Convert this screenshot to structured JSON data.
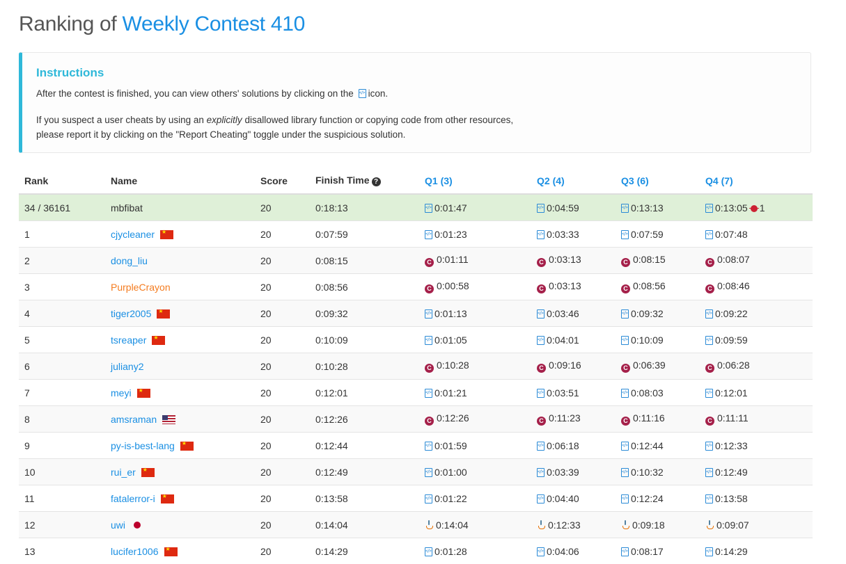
{
  "header": {
    "title_prefix": "Ranking of",
    "contest_name": "Weekly Contest 410"
  },
  "instructions": {
    "title": "Instructions",
    "p1_before": "After the contest is finished, you can view others' solutions by clicking on the",
    "p1_after": "icon.",
    "p2_line1_before": "If you suspect a user cheats by using an",
    "p2_emphasis": "explicitly",
    "p2_line1_after": "disallowed library function or copying code from other resources,",
    "p2_line2": "please report it by clicking on the \"Report Cheating\" toggle under the suspicious solution."
  },
  "table": {
    "headers": {
      "rank": "Rank",
      "name": "Name",
      "score": "Score",
      "finish": "Finish Time",
      "q1": "Q1 (3)",
      "q2": "Q2 (4)",
      "q3": "Q3 (6)",
      "q4": "Q4 (7)"
    },
    "current_user": {
      "rank": "34 / 36161",
      "name": "mbfibat",
      "score": "20",
      "finish": "0:18:13",
      "q1": "0:01:47",
      "q2": "0:04:59",
      "q3": "0:13:13",
      "q4": "0:13:05",
      "q4_bugs": "1"
    },
    "rows": [
      {
        "rank": "1",
        "name": "cjycleaner",
        "flag": "cn",
        "color": "blue",
        "score": "20",
        "finish": "0:07:59",
        "lang": "code",
        "q1": "0:01:23",
        "q2": "0:03:33",
        "q3": "0:07:59",
        "q4": "0:07:48"
      },
      {
        "rank": "2",
        "name": "dong_liu",
        "flag": "",
        "color": "blue",
        "score": "20",
        "finish": "0:08:15",
        "lang": "cpp",
        "q1": "0:01:11",
        "q2": "0:03:13",
        "q3": "0:08:15",
        "q4": "0:08:07"
      },
      {
        "rank": "3",
        "name": "PurpleCrayon",
        "flag": "",
        "color": "orange",
        "score": "20",
        "finish": "0:08:56",
        "lang": "cpp",
        "q1": "0:00:58",
        "q2": "0:03:13",
        "q3": "0:08:56",
        "q4": "0:08:46"
      },
      {
        "rank": "4",
        "name": "tiger2005",
        "flag": "cn",
        "color": "blue",
        "score": "20",
        "finish": "0:09:32",
        "lang": "code",
        "q1": "0:01:13",
        "q2": "0:03:46",
        "q3": "0:09:32",
        "q4": "0:09:22"
      },
      {
        "rank": "5",
        "name": "tsreaper",
        "flag": "cn",
        "color": "blue",
        "score": "20",
        "finish": "0:10:09",
        "lang": "code",
        "q1": "0:01:05",
        "q2": "0:04:01",
        "q3": "0:10:09",
        "q4": "0:09:59"
      },
      {
        "rank": "6",
        "name": "juliany2",
        "flag": "",
        "color": "blue",
        "score": "20",
        "finish": "0:10:28",
        "lang": "cpp",
        "q1": "0:10:28",
        "q2": "0:09:16",
        "q3": "0:06:39",
        "q4": "0:06:28"
      },
      {
        "rank": "7",
        "name": "meyi",
        "flag": "cn",
        "color": "blue",
        "score": "20",
        "finish": "0:12:01",
        "lang": "code",
        "q1": "0:01:21",
        "q2": "0:03:51",
        "q3": "0:08:03",
        "q4": "0:12:01"
      },
      {
        "rank": "8",
        "name": "amsraman",
        "flag": "us",
        "color": "blue",
        "score": "20",
        "finish": "0:12:26",
        "lang": "cpp",
        "q1": "0:12:26",
        "q2": "0:11:23",
        "q3": "0:11:16",
        "q4": "0:11:11"
      },
      {
        "rank": "9",
        "name": "py-is-best-lang",
        "flag": "cn",
        "color": "blue",
        "score": "20",
        "finish": "0:12:44",
        "lang": "code",
        "q1": "0:01:59",
        "q2": "0:06:18",
        "q3": "0:12:44",
        "q4": "0:12:33"
      },
      {
        "rank": "10",
        "name": "rui_er",
        "flag": "cn",
        "color": "blue",
        "score": "20",
        "finish": "0:12:49",
        "lang": "code",
        "q1": "0:01:00",
        "q2": "0:03:39",
        "q3": "0:10:32",
        "q4": "0:12:49"
      },
      {
        "rank": "11",
        "name": "fatalerror-i",
        "flag": "cn",
        "color": "blue",
        "score": "20",
        "finish": "0:13:58",
        "lang": "code",
        "q1": "0:01:22",
        "q2": "0:04:40",
        "q3": "0:12:24",
        "q4": "0:13:58"
      },
      {
        "rank": "12",
        "name": "uwi",
        "flag": "jp",
        "color": "blue",
        "score": "20",
        "finish": "0:14:04",
        "lang": "java",
        "q1": "0:14:04",
        "q2": "0:12:33",
        "q3": "0:09:18",
        "q4": "0:09:07"
      },
      {
        "rank": "13",
        "name": "lucifer1006",
        "flag": "cn",
        "color": "blue",
        "score": "20",
        "finish": "0:14:29",
        "lang": "code",
        "q1": "0:01:28",
        "q2": "0:04:06",
        "q3": "0:08:17",
        "q4": "0:14:29"
      }
    ]
  }
}
